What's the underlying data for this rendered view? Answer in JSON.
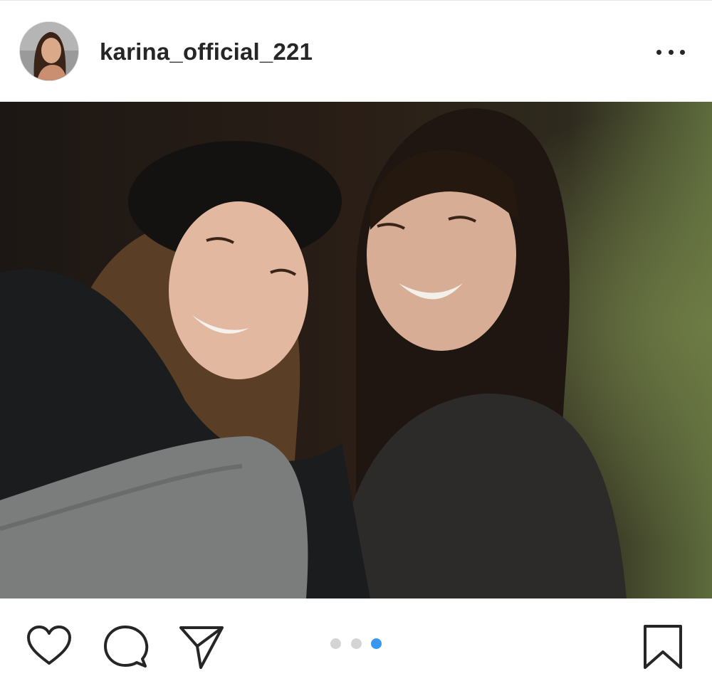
{
  "post": {
    "username": "karina_official_221",
    "avatar_icon": "profile-photo",
    "more_icon": "more-horizontal-icon"
  },
  "media": {
    "description_icon": "photo",
    "carousel": {
      "count": 3,
      "active_index": 2
    }
  },
  "actions": {
    "like_icon": "heart-icon",
    "comment_icon": "comment-icon",
    "share_icon": "send-icon",
    "save_icon": "bookmark-icon"
  },
  "colors": {
    "text": "#262626",
    "dot_inactive": "#d4d4d4",
    "dot_active": "#3897f0"
  }
}
